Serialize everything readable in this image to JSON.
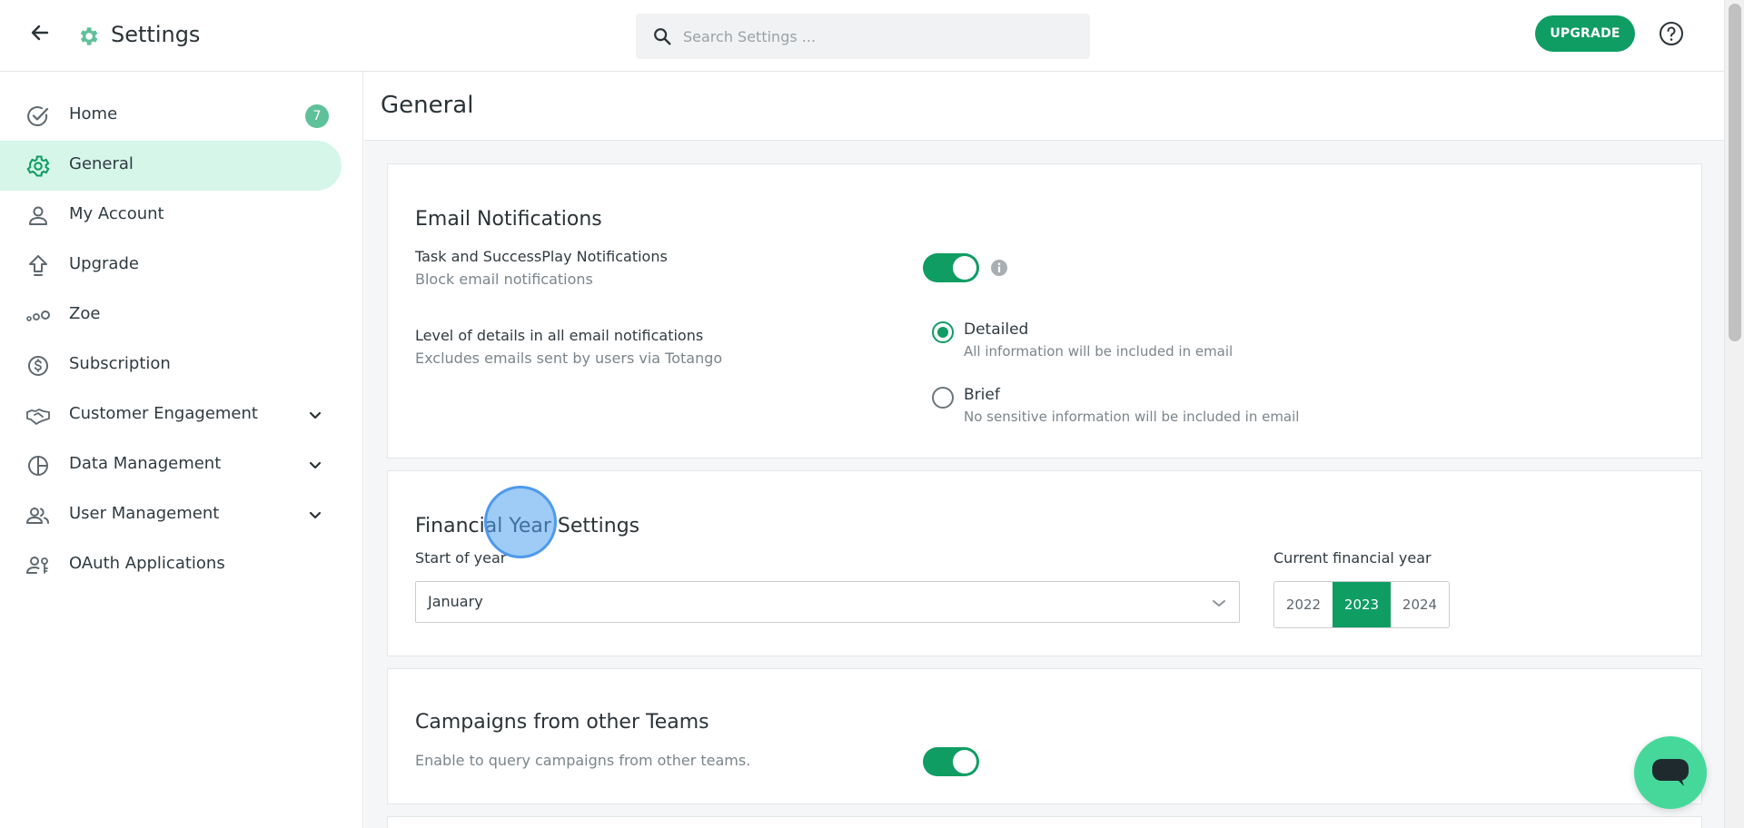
{
  "header": {
    "title": "Settings",
    "search_placeholder": "Search Settings ...",
    "upgrade_label": "UPGRADE"
  },
  "sidebar": {
    "items": [
      {
        "label": "Home",
        "icon": "check-circle-icon",
        "badge": "7"
      },
      {
        "label": "General",
        "icon": "gear-icon",
        "active": true
      },
      {
        "label": "My Account",
        "icon": "person-icon"
      },
      {
        "label": "Upgrade",
        "icon": "upgrade-arrow-icon"
      },
      {
        "label": "Zoe",
        "icon": "dots-icon"
      },
      {
        "label": "Subscription",
        "icon": "dollar-circle-icon"
      },
      {
        "label": "Customer Engagement",
        "icon": "handshake-icon",
        "expandable": true
      },
      {
        "label": "Data Management",
        "icon": "pie-chart-icon",
        "expandable": true
      },
      {
        "label": "User Management",
        "icon": "users-icon",
        "expandable": true
      },
      {
        "label": "OAuth Applications",
        "icon": "user-key-icon"
      }
    ]
  },
  "main": {
    "title": "General",
    "email": {
      "title": "Email Notifications",
      "task_label": "Task and SuccessPlay Notifications",
      "task_sub": "Block email notifications",
      "task_toggle": true,
      "detail_label": "Level of details in all email notifications",
      "detail_sub": "Excludes emails sent by users via Totango",
      "options": [
        {
          "label": "Detailed",
          "desc": "All information will be included in email",
          "selected": true
        },
        {
          "label": "Brief",
          "desc": "No sensitive information will be included in email",
          "selected": false
        }
      ]
    },
    "financial": {
      "title": "Financial Year Settings",
      "start_label": "Start of year",
      "start_value": "January",
      "current_label": "Current financial year",
      "years": [
        "2022",
        "2023",
        "2024"
      ],
      "selected_year": "2023"
    },
    "campaigns": {
      "title": "Campaigns from other Teams",
      "sub": "Enable to query campaigns from other teams.",
      "toggle": true
    }
  },
  "colors": {
    "accent": "#0f9d63",
    "active_bg": "#d6f6ea",
    "badge": "#5fc19a",
    "chat": "#46d89a"
  }
}
